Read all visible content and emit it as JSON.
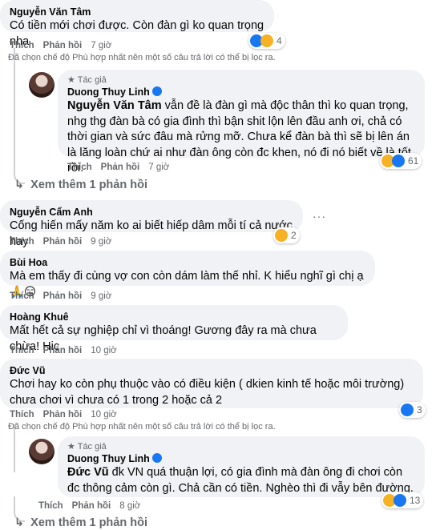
{
  "ui": {
    "like": "Thích",
    "reply": "Phản hồi",
    "filter_note": "Đã chọn chế độ Phù hợp nhất nên một số câu trả lời có thể bị lọc ra.",
    "view_more": "Xem thêm 1 phản hồi",
    "author_tag": "Tác giả",
    "dots": "···"
  },
  "comments": [
    {
      "name": "Nguyễn Văn Tâm",
      "text": "Có tiền mới chơi được. Còn đàn gì ko quan trọng nha",
      "time": "7 giờ",
      "reactions": "4",
      "reaction_icons": [
        "like-icon",
        "haha-icon"
      ]
    },
    {
      "name": "Duong Thuy Linh",
      "mention": "Nguyễn Văn Tâm",
      "text": "vẫn đề là đàn gì mà độc thân thì ko quan trọng, nhg thg đàn bà có gia đình thì bận shit lộn lên đầu anh ơi, chả có thời gian và sức đâu mà rửng mỡ. Chưa kể đàn bà thì sẽ bị lên án là lăng loàn chứ ai như đàn ông còn đc khen, nó đi nó biết về là tốt rồi.",
      "time": "7 giờ",
      "reactions": "61",
      "reaction_icons": [
        "haha-icon",
        "like-icon"
      ]
    },
    {
      "name": "Nguyễn Cẩm Anh",
      "text": "Cống hiến mấy năm ko ai biết hiếp dâm mỗi tí cả nước hay",
      "time": "9 giờ",
      "reactions": "2",
      "reaction_icons": [
        "haha-icon"
      ]
    },
    {
      "name": "Bùi Hoa",
      "text": "Mà em thấy đi cùng vợ con còn dám làm thế nhỉ. K hiểu nghĩ gì chị ạ 🙏😑",
      "time": "9 giờ"
    },
    {
      "name": "Hoàng Khuê",
      "text": "Mất hết cả sự nghiệp chỉ vì thoáng! Gương đây ra mà chưa chừa! Hic",
      "time": "10 giờ"
    },
    {
      "name": "Đức Vũ",
      "text": "Chơi hay ko còn phụ thuộc vào có điều kiện ( dkien kinh tế hoặc môi trường) chưa chơi vì chưa có 1 trong 2 hoặc cả 2",
      "time": "10 giờ",
      "reactions": "3",
      "reaction_icons": [
        "like-icon"
      ]
    },
    {
      "name": "Duong Thuy Linh",
      "mention": "Đức Vũ",
      "text": "đk VN quá thuận lợi, có gia đình mà đàn ông đi chơi còn đc thông cảm còn gì. Chả cần có tiền. Nghèo thì đi vẫy bên đường.",
      "time": "8 giờ",
      "reactions": "13",
      "reaction_icons": [
        "haha-icon",
        "like-icon"
      ]
    }
  ],
  "colors": {
    "bubble": "#f0f2f5",
    "secondary_text": "#65676b",
    "like_blue": "#1877f2",
    "haha_yellow": "#f7b125"
  }
}
